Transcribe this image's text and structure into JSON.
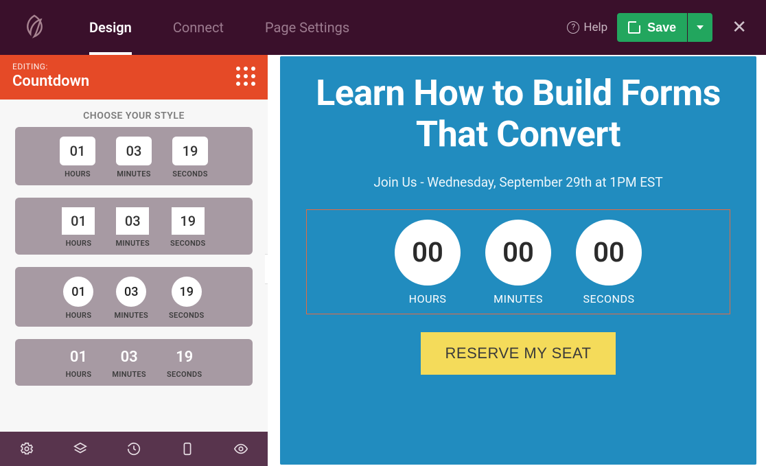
{
  "header": {
    "tabs": {
      "design": "Design",
      "connect": "Connect",
      "settings": "Page Settings"
    },
    "help": "Help",
    "save": "Save"
  },
  "panel": {
    "editing_label": "EDITING:",
    "editing_name": "Countdown",
    "choose_style": "CHOOSE YOUR STYLE",
    "sample": {
      "h": "01",
      "m": "03",
      "s": "19"
    },
    "labels": {
      "hours": "HOURS",
      "minutes": "MINUTES",
      "seconds": "SECONDS"
    }
  },
  "canvas": {
    "headline": "Learn How to Build Forms That Convert",
    "subhead": "Join Us - Wednesday, September 29th at 1PM EST",
    "countdown": {
      "h": "00",
      "m": "00",
      "s": "00"
    },
    "labels": {
      "hours": "HOURS",
      "minutes": "MINUTES",
      "seconds": "SECONDS"
    },
    "cta": "RESERVE MY SEAT"
  }
}
